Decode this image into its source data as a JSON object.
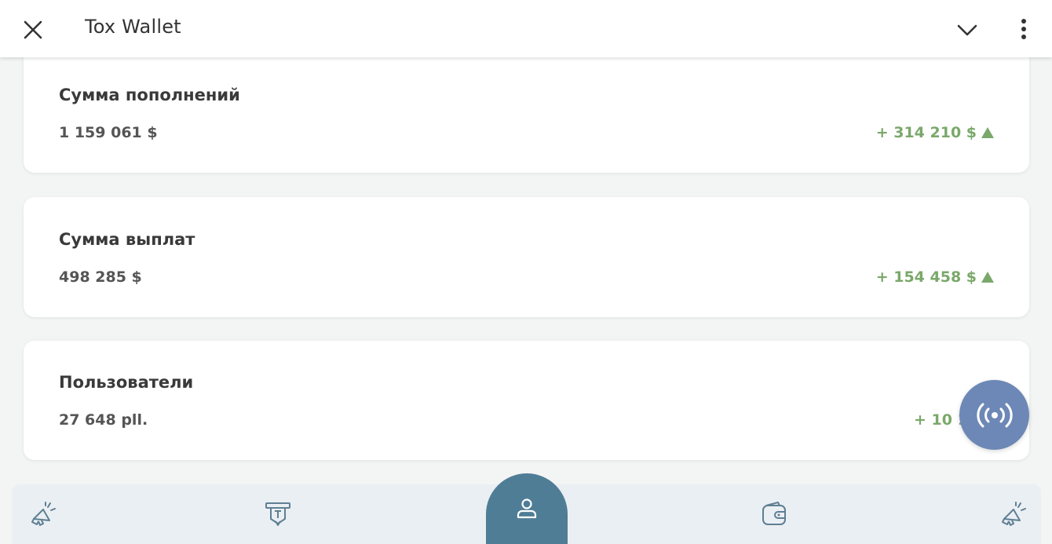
{
  "app_bar": {
    "title": "Tox Wallet",
    "close_icon": "close-icon",
    "collapse_icon": "chevron-down-icon",
    "menu_icon": "more-vertical-icon"
  },
  "cards": [
    {
      "title": "Сумма пополнений",
      "value": "1 159 061 $",
      "delta": "+ 314 210 $",
      "trend": "up"
    },
    {
      "title": "Сумма выплат",
      "value": "498 285 $",
      "delta": "+ 154 458 $",
      "trend": "up"
    },
    {
      "title": "Пользователи",
      "value": "27 648 pll.",
      "delta": "+ 10 12",
      "trend": "up"
    }
  ],
  "fab": {
    "icon": "broadcast-icon"
  },
  "bottom_nav": {
    "items": [
      {
        "icon": "megaphone-icon",
        "active": false
      },
      {
        "icon": "atm-icon",
        "active": false
      },
      {
        "icon": "user-icon",
        "active": true
      },
      {
        "icon": "wallet-icon",
        "active": false
      },
      {
        "icon": "megaphone-icon",
        "active": false
      }
    ]
  },
  "colors": {
    "background": "#f3f4f4",
    "card": "#ffffff",
    "positive": "#7aa86a",
    "fab": "#6d88b6",
    "nav_bg": "#eaeff3",
    "nav_active": "#4f7d96",
    "nav_icon": "#5f7f93"
  }
}
